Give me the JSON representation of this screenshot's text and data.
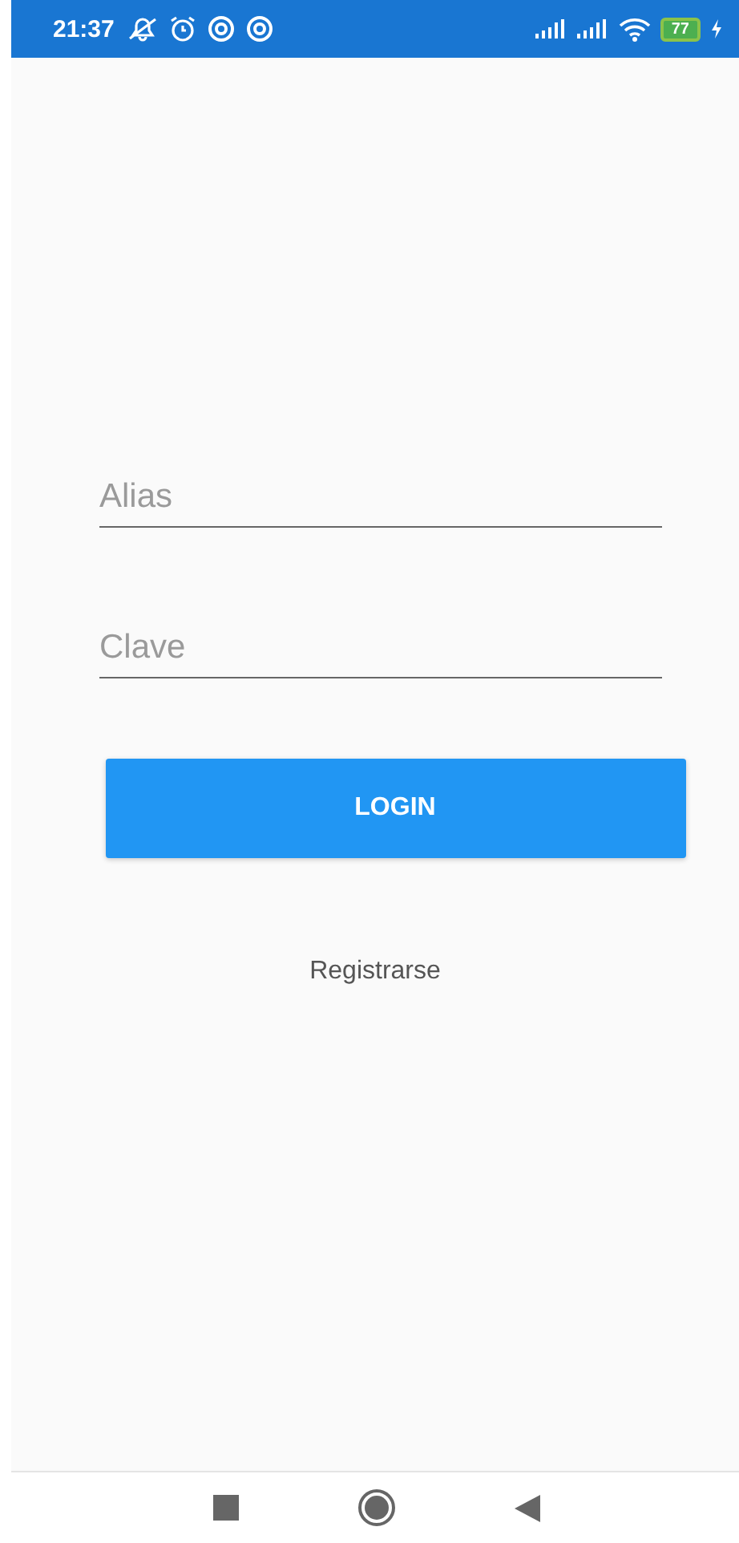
{
  "status_bar": {
    "time": "21:37",
    "battery": "77"
  },
  "fields": [
    {
      "placeholder": "Alias"
    },
    {
      "placeholder": "Clave"
    }
  ],
  "login_button": "LOGIN",
  "register_link": "Registrarse"
}
